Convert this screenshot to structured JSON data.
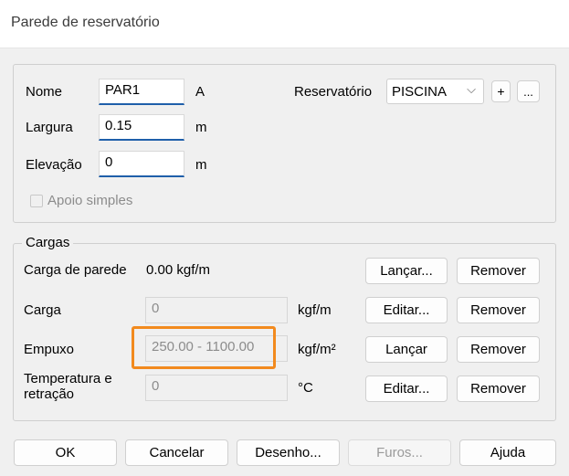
{
  "window": {
    "title": "Parede de reservatório"
  },
  "wall": {
    "nome_label": "Nome",
    "nome_value": "PAR1",
    "nome_suffix": "A",
    "largura_label": "Largura",
    "largura_value": "0.15",
    "largura_unit": "m",
    "elevacao_label": "Elevação",
    "elevacao_value": "0",
    "elevacao_unit": "m",
    "apoio_label": "Apoio simples",
    "apoio_checked": false,
    "reservatorio_label": "Reservatório",
    "reservatorio_value": "PISCINA",
    "add_label": "+",
    "more_label": "..."
  },
  "cargas": {
    "legend": "Cargas",
    "carga_parede": {
      "label": "Carga de parede",
      "value": "0.00 kgf/m",
      "button1": "Lançar...",
      "button2": "Remover"
    },
    "carga": {
      "label": "Carga",
      "value": "0",
      "unit": "kgf/m",
      "button1": "Editar...",
      "button2": "Remover"
    },
    "empuxo": {
      "label": "Empuxo",
      "value": "250.00 - 1100.00",
      "unit": "kgf/m²",
      "button1": "Lançar",
      "button2": "Remover"
    },
    "temperatura": {
      "label_line1": "Temperatura e",
      "label_line2": "retração",
      "value": "0",
      "unit": "°C",
      "button1": "Editar...",
      "button2": "Remover"
    }
  },
  "footer": {
    "ok": "OK",
    "cancelar": "Cancelar",
    "desenho": "Desenho...",
    "furos": "Furos...",
    "ajuda": "Ajuda"
  },
  "colors": {
    "highlight": "#f28a1e",
    "focus_underline": "#1f5faa"
  }
}
